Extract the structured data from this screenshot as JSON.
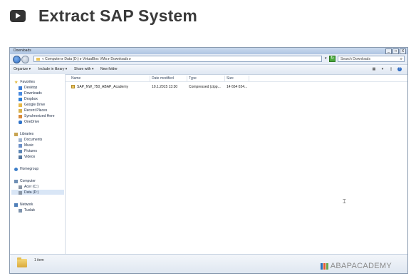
{
  "header": {
    "title": "Extract SAP System",
    "icon": "video-play-icon"
  },
  "window": {
    "title": "Downloads",
    "address_path": "« Computer ▸ Data (D:) ▸ VirtualBox VMs ▸ Downloads ▸",
    "search_placeholder": "Search Downloads",
    "controls": {
      "minimize": "_",
      "maximize": "□",
      "close": "X"
    }
  },
  "toolbar": {
    "organize": "Organize ▾",
    "include_in_library": "Include in library ▾",
    "share_with": "Share with ▾",
    "new_folder": "New folder"
  },
  "sidebar": {
    "favorites_label": "Favorites",
    "favorites": [
      "Desktop",
      "Downloads",
      "Dropbox",
      "Google Drive",
      "Recent Places",
      "Synchronized Here",
      "OneDrive"
    ],
    "libraries_label": "Libraries",
    "libraries": [
      "Documents",
      "Music",
      "Pictures",
      "Videos"
    ],
    "homegroup_label": "Homegroup",
    "computer_label": "Computer",
    "computer": [
      "Acer (C:)",
      "Data (D:)"
    ],
    "network_label": "Network",
    "network": [
      "Tuxlab"
    ]
  },
  "columns": [
    "Name",
    "Date modified",
    "Type",
    "Size"
  ],
  "files": [
    {
      "name": "SAP_NW_750_ABAP_Academy",
      "date": "10.1.2015 13:30",
      "type": "Compressed (zipp...",
      "size": "14 654 024..."
    }
  ],
  "status": {
    "item_count": "1 item"
  },
  "branding": {
    "name": "ABAPACADEMY",
    "colors": [
      "#2c6fb7",
      "#e35a2d",
      "#6aa84f",
      "#f1b434"
    ]
  }
}
